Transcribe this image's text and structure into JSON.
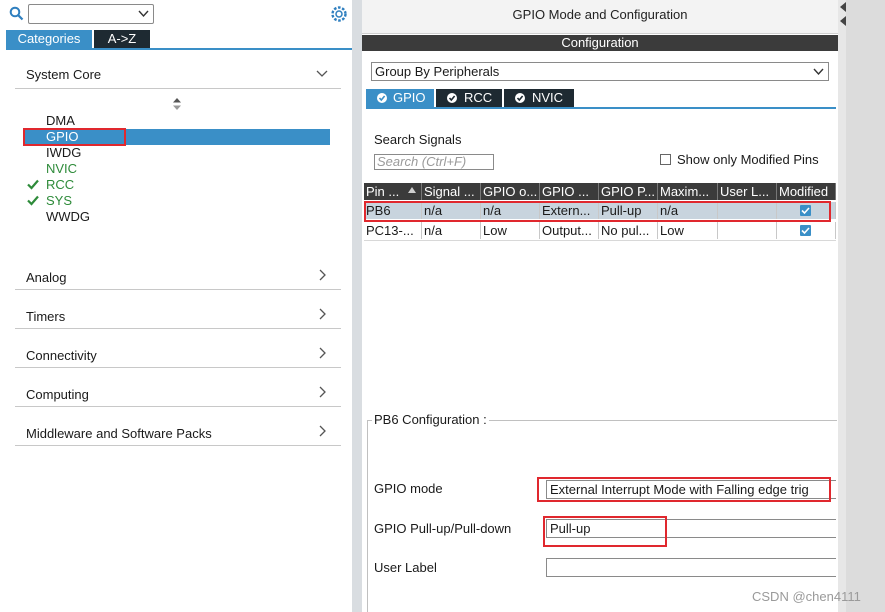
{
  "left_panel": {
    "search_value": "",
    "tabs": [
      "Categories",
      "A->Z"
    ],
    "system_core": {
      "label": "System Core",
      "items": [
        {
          "label": "DMA",
          "status": "none"
        },
        {
          "label": "GPIO",
          "status": "selected"
        },
        {
          "label": "IWDG",
          "status": "none"
        },
        {
          "label": "NVIC",
          "status": "none"
        },
        {
          "label": "RCC",
          "status": "configured"
        },
        {
          "label": "SYS",
          "status": "configured"
        },
        {
          "label": "WWDG",
          "status": "none"
        }
      ]
    },
    "categories": [
      "Analog",
      "Timers",
      "Connectivity",
      "Computing",
      "Middleware and Software Packs"
    ]
  },
  "right_panel": {
    "title": "GPIO Mode and Configuration",
    "config_header": "Configuration",
    "group_by": "Group By Peripherals",
    "periph_tabs": [
      "GPIO",
      "RCC",
      "NVIC"
    ],
    "search_label": "Search Signals",
    "search_placeholder": "Search (Ctrl+F)",
    "show_modified_label": "Show only Modified Pins",
    "table": {
      "columns": [
        "Pin ...",
        "Signal ...",
        "GPIO o...",
        "GPIO ...",
        "GPIO P...",
        "Maxim...",
        "User L...",
        "Modified"
      ],
      "rows": [
        [
          "PB6",
          "n/a",
          "n/a",
          "Extern...",
          "Pull-up",
          "n/a",
          "",
          ""
        ],
        [
          "PC13-...",
          "n/a",
          "Low",
          "Output...",
          "No pul...",
          "Low",
          "",
          ""
        ]
      ]
    },
    "pin_config_title": "PB6 Configuration :",
    "fields": {
      "gpio_mode_label": "GPIO mode",
      "gpio_mode_value": "External Interrupt Mode with Falling edge trig",
      "pull_label": "GPIO Pull-up/Pull-down",
      "pull_value": "Pull-up",
      "user_label_label": "User Label",
      "user_label_value": ""
    }
  },
  "watermark": "CSDN @chen4111",
  "colors": {
    "accent": "#3a8fc7",
    "dark": "#3b3b3b",
    "highlight": "#e0282e",
    "ok": "#2e8b3a"
  }
}
